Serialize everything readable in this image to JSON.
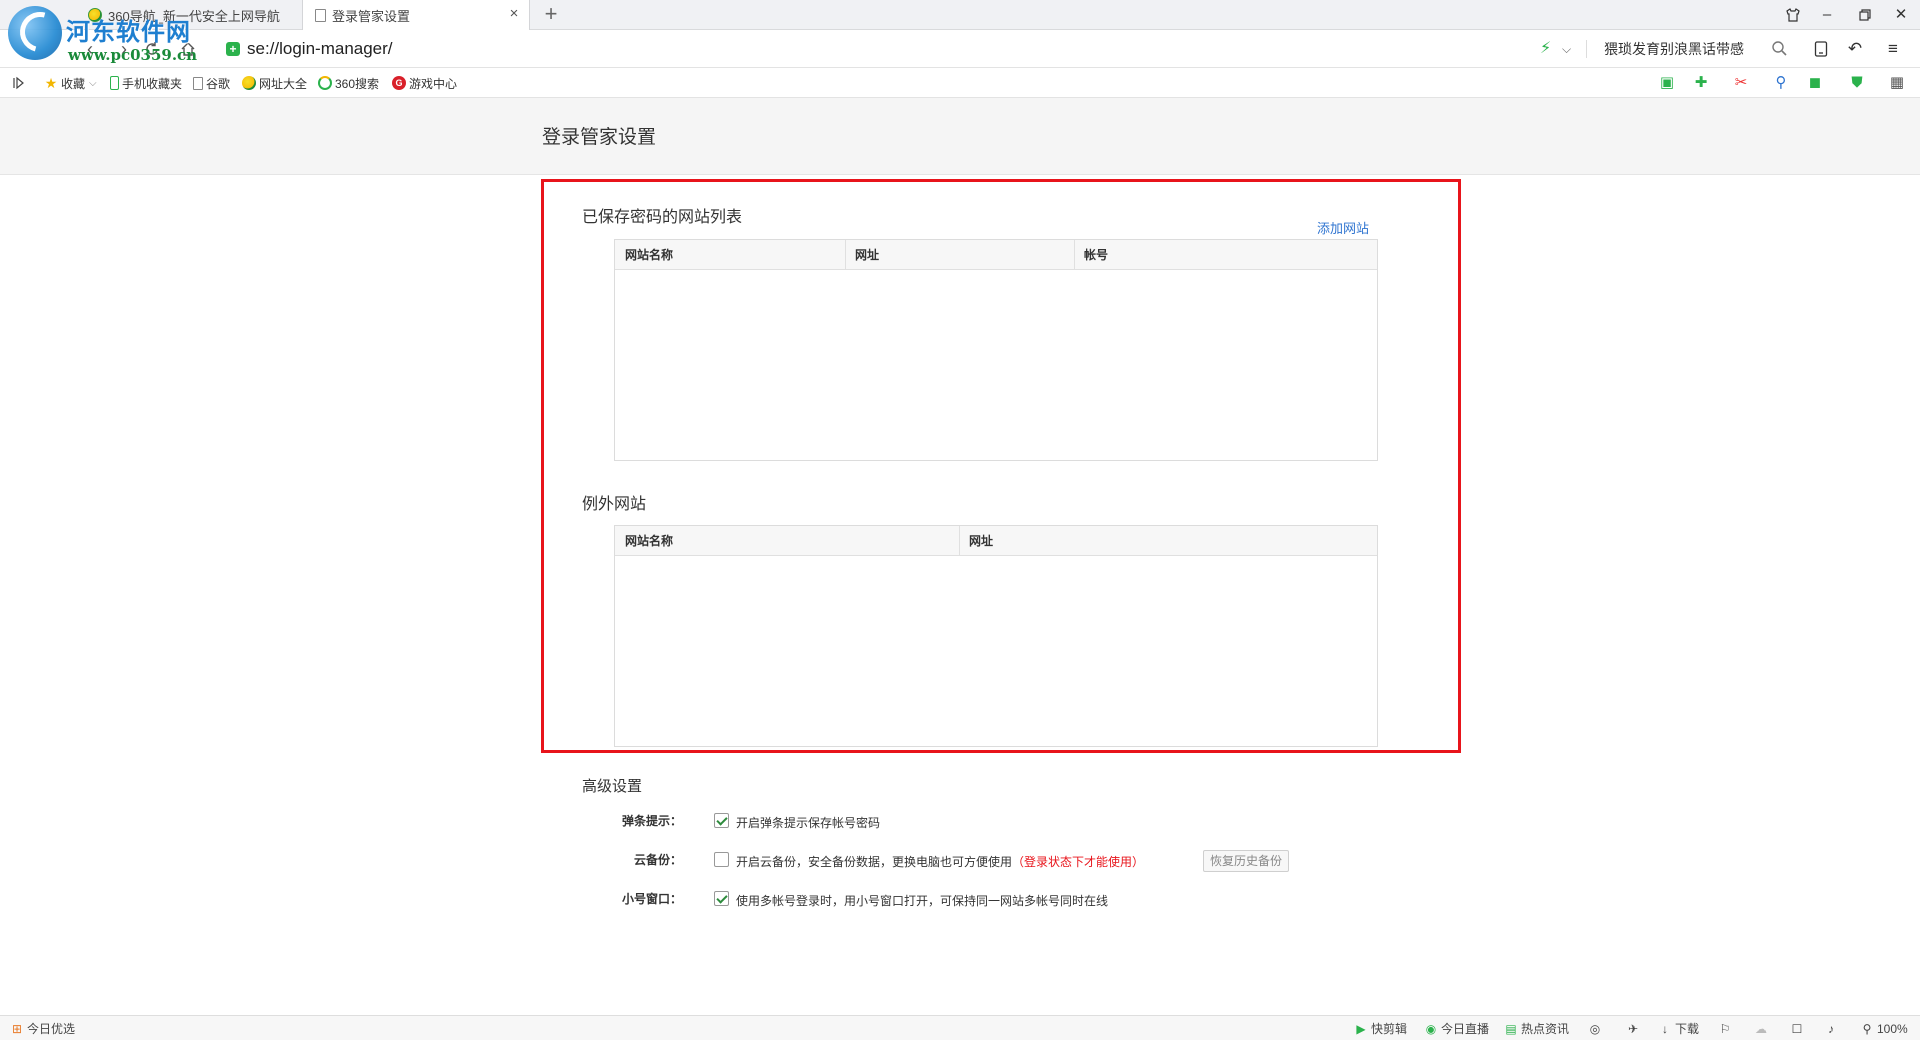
{
  "tabs": [
    {
      "label": "360导航_新一代安全上网导航",
      "active": false
    },
    {
      "label": "登录管家设置",
      "active": true
    }
  ],
  "watermark": {
    "title": "河东软件网",
    "url": "www.pc0359.cn"
  },
  "address_bar": {
    "url": "se://login-manager/",
    "hot_search": "猥琐发育别浪黑话带感"
  },
  "bookmarks": [
    "收藏",
    "手机收藏夹",
    "谷歌",
    "网址大全",
    "360搜索",
    "游戏中心"
  ],
  "page": {
    "title": "登录管家设置",
    "saved_section": {
      "title": "已保存密码的网站列表",
      "add_link": "添加网站",
      "columns": [
        "网站名称",
        "网址",
        "帐号"
      ],
      "rows": []
    },
    "exception_section": {
      "title": "例外网站",
      "columns": [
        "网站名称",
        "网址"
      ],
      "rows": []
    },
    "advanced": {
      "title": "高级设置",
      "popup": {
        "label": "弹条提示：",
        "text": "开启弹条提示保存帐号密码",
        "checked": true
      },
      "cloud": {
        "label": "云备份：",
        "text": "开启云备份，安全备份数据，更换电脑也可方便使用",
        "warning": "（登录状态下才能使用）",
        "button": "恢复历史备份",
        "checked": false
      },
      "small_window": {
        "label": "小号窗口：",
        "text": "使用多帐号登录时，用小号窗口打开，可保持同一网站多帐号同时在线",
        "checked": true
      }
    }
  },
  "status_bar": {
    "left": "今日优选",
    "items": [
      "快剪辑",
      "今日直播",
      "热点资讯",
      "下载"
    ],
    "zoom": "100%"
  },
  "colors": {
    "highlight": "#e8141b",
    "link": "#2f74d0",
    "check": "#2e8b3d"
  }
}
